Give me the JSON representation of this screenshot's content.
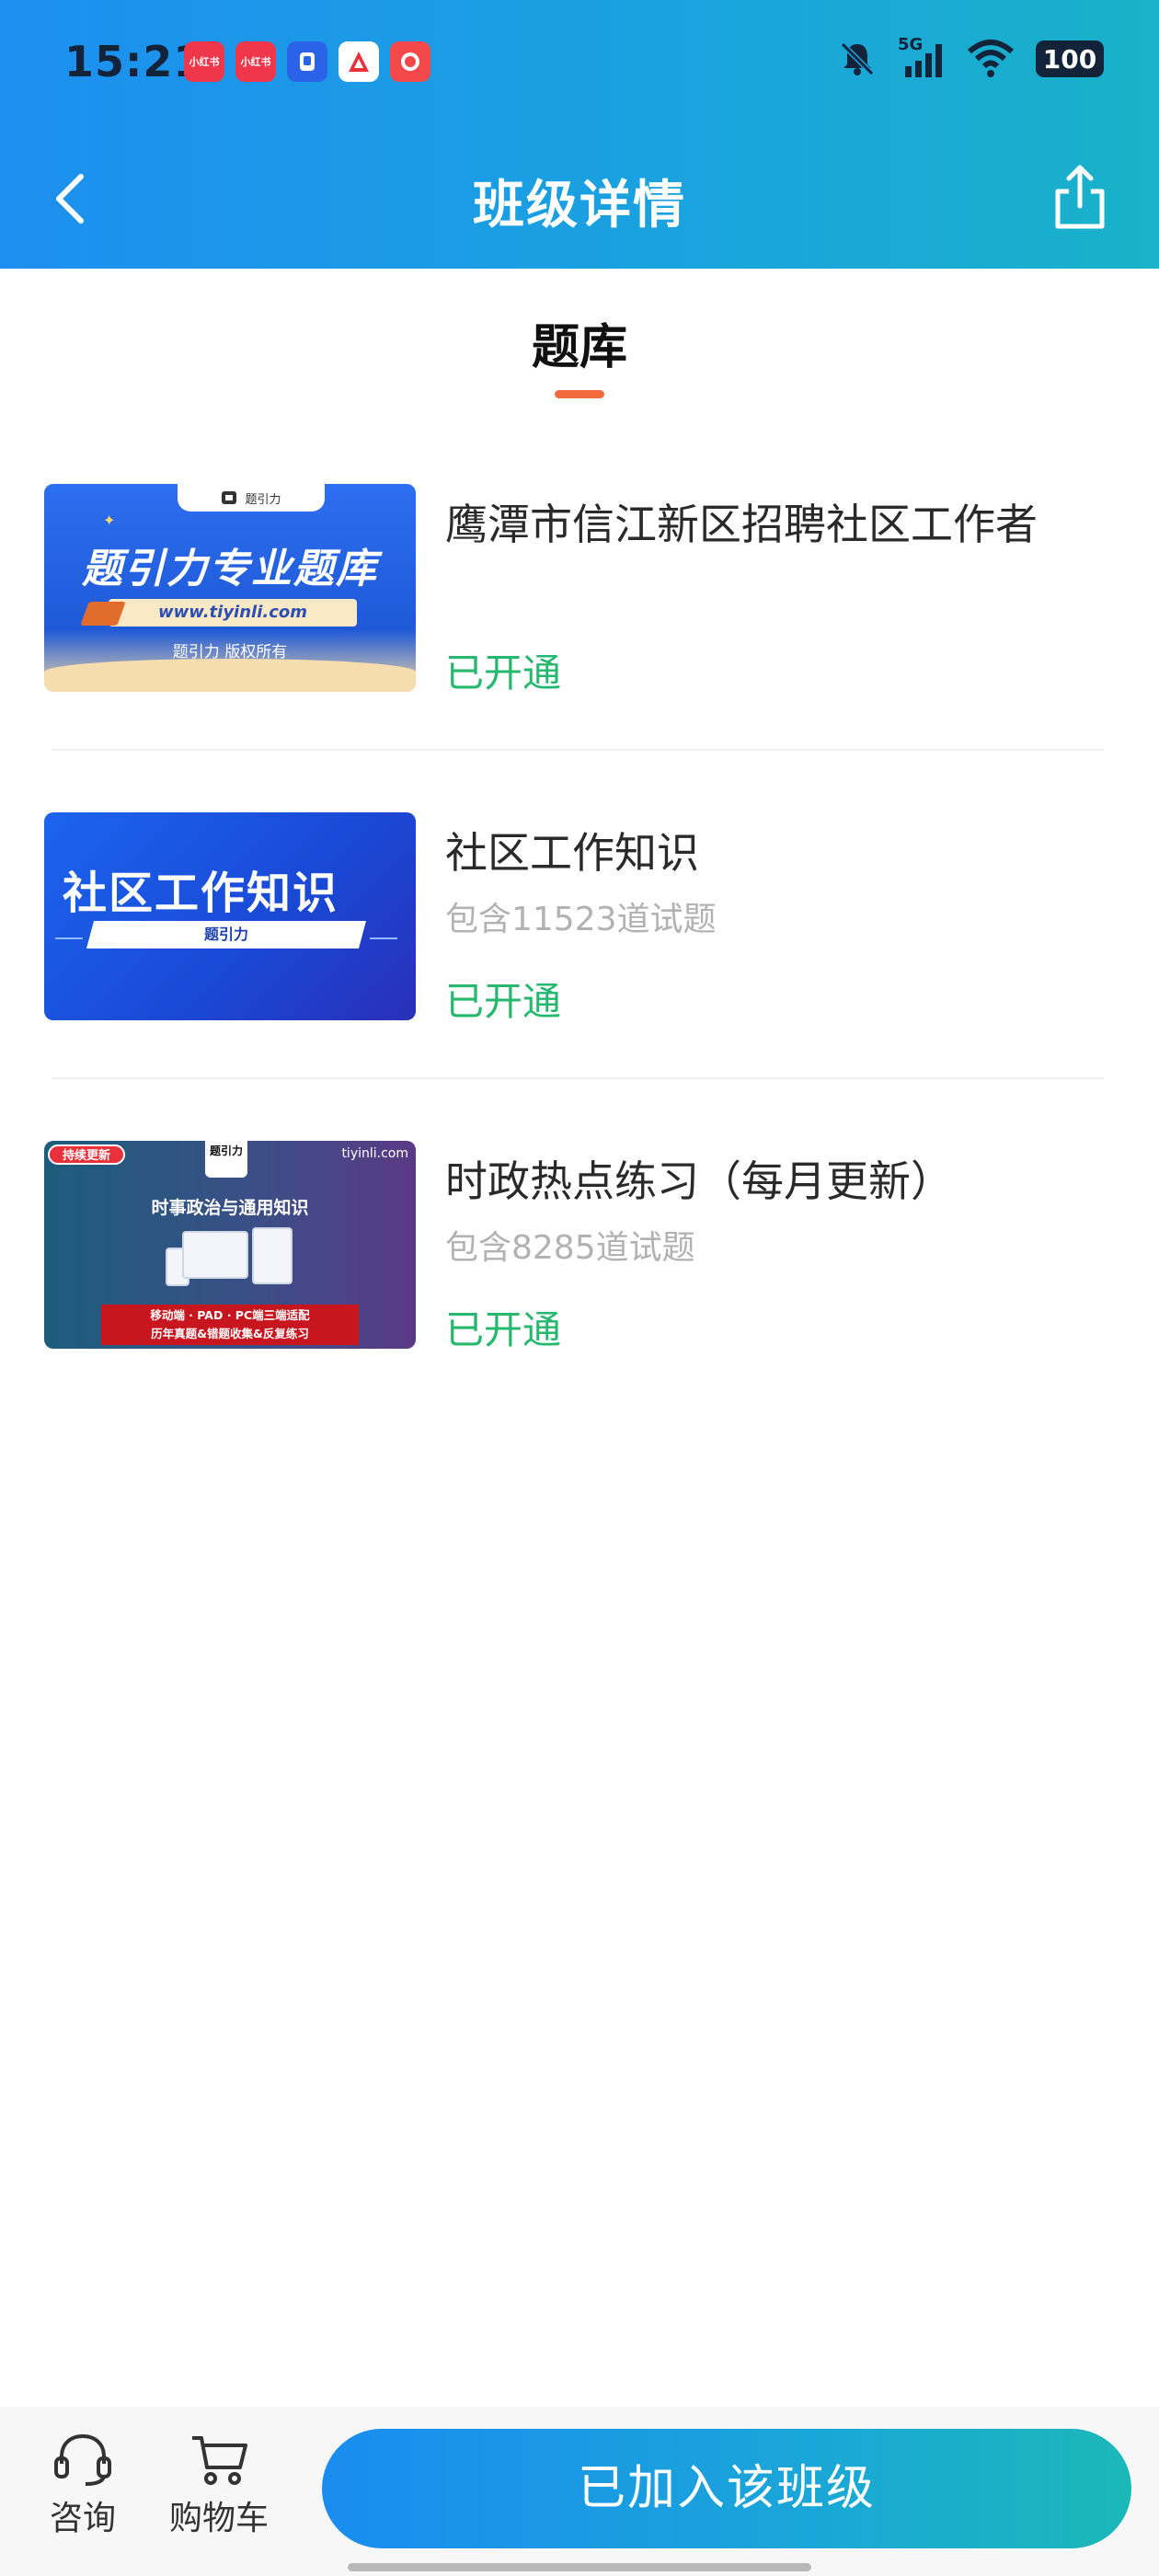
{
  "status_bar": {
    "time": "15:21",
    "app_icons": [
      {
        "name": "xiaohongshu-icon",
        "text": "小红书"
      },
      {
        "name": "xiaohongshu-icon",
        "text": "小红书"
      },
      {
        "name": "app-blue-icon",
        "text": ""
      },
      {
        "name": "app-white-icon",
        "text": ""
      },
      {
        "name": "app-orange-icon",
        "text": ""
      }
    ],
    "network": "5G",
    "battery": "100"
  },
  "header": {
    "title": "班级详情",
    "back_icon": "chevron-left-icon",
    "share_icon": "share-icon"
  },
  "section": {
    "tab_label": "题库",
    "accent_color": "#f26a3d"
  },
  "items": [
    {
      "title": "鹰潭市信江新区招聘社区工作者",
      "subtitle": "",
      "status": "已开通",
      "thumb": {
        "top_tab": "题引力",
        "big_text": "题引力专业题库",
        "url": "www.tiyinli.com",
        "copyright": "题引力 版权所有"
      }
    },
    {
      "title": "社区工作知识",
      "subtitle": "包含11523道试题",
      "status": "已开通",
      "thumb": {
        "big_text": "社区工作知识",
        "band": "题引力"
      }
    },
    {
      "title": "时政热点练习（每月更新）",
      "subtitle": "包含8285道试题",
      "status": "已开通",
      "thumb": {
        "badge": "持续更新",
        "logo": "题引力",
        "site": "tiyinli.com",
        "heading": "时事政治与通用知识",
        "red_line1": "移动端 · PAD · PC端三端适配",
        "red_line2": "历年真题&错题收集&反复练习"
      }
    }
  ],
  "bottom_bar": {
    "consult_label": "咨询",
    "consult_icon": "headset-icon",
    "cart_label": "购物车",
    "cart_icon": "cart-icon",
    "join_label": "已加入该班级"
  },
  "colors": {
    "header_gradient_start": "#1d8ff0",
    "header_gradient_end": "#19b2c8",
    "status_green": "#25b86e",
    "subtitle_gray": "#b2b2b2"
  }
}
